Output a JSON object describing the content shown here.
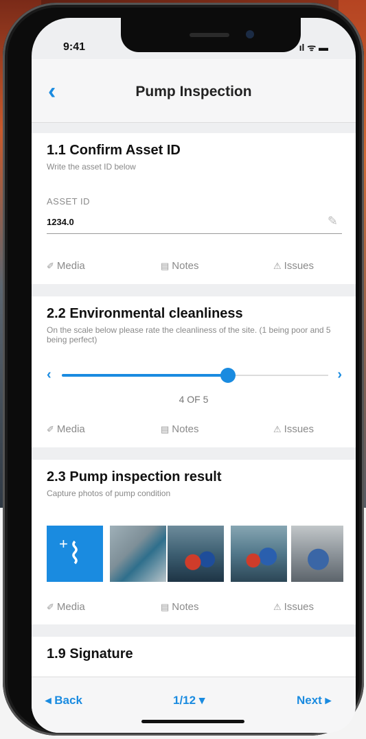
{
  "status_bar": {
    "time": "9:41",
    "icons": "ıl ᯤ ▬"
  },
  "header": {
    "back_icon": "chevron-left-icon",
    "back_glyph": "‹",
    "title": "Pump Inspection"
  },
  "actions": {
    "media": "Media",
    "notes": "Notes",
    "issues": "Issues"
  },
  "sections": {
    "asset": {
      "title": "1.1 Confirm Asset ID",
      "subtitle": "Write the asset ID below",
      "field_label": "ASSET ID",
      "field_value": "1234.0"
    },
    "cleanliness": {
      "title": "2.2 Environmental cleanliness",
      "subtitle": "On the scale below please rate the cleanliness of the site. (1 being poor and 5 being perfect)",
      "slider_value": 4,
      "slider_max": 5,
      "level_text": "4 OF 5"
    },
    "pump": {
      "title": "2.3 Pump inspection result",
      "subtitle": "Capture photos of pump condition"
    },
    "signature": {
      "title": "1.9 Signature"
    }
  },
  "footer": {
    "back_label": "◂ Back",
    "page_label": "1/12",
    "next_label": "Next ▸"
  },
  "colors": {
    "accent": "#1a8be0"
  }
}
